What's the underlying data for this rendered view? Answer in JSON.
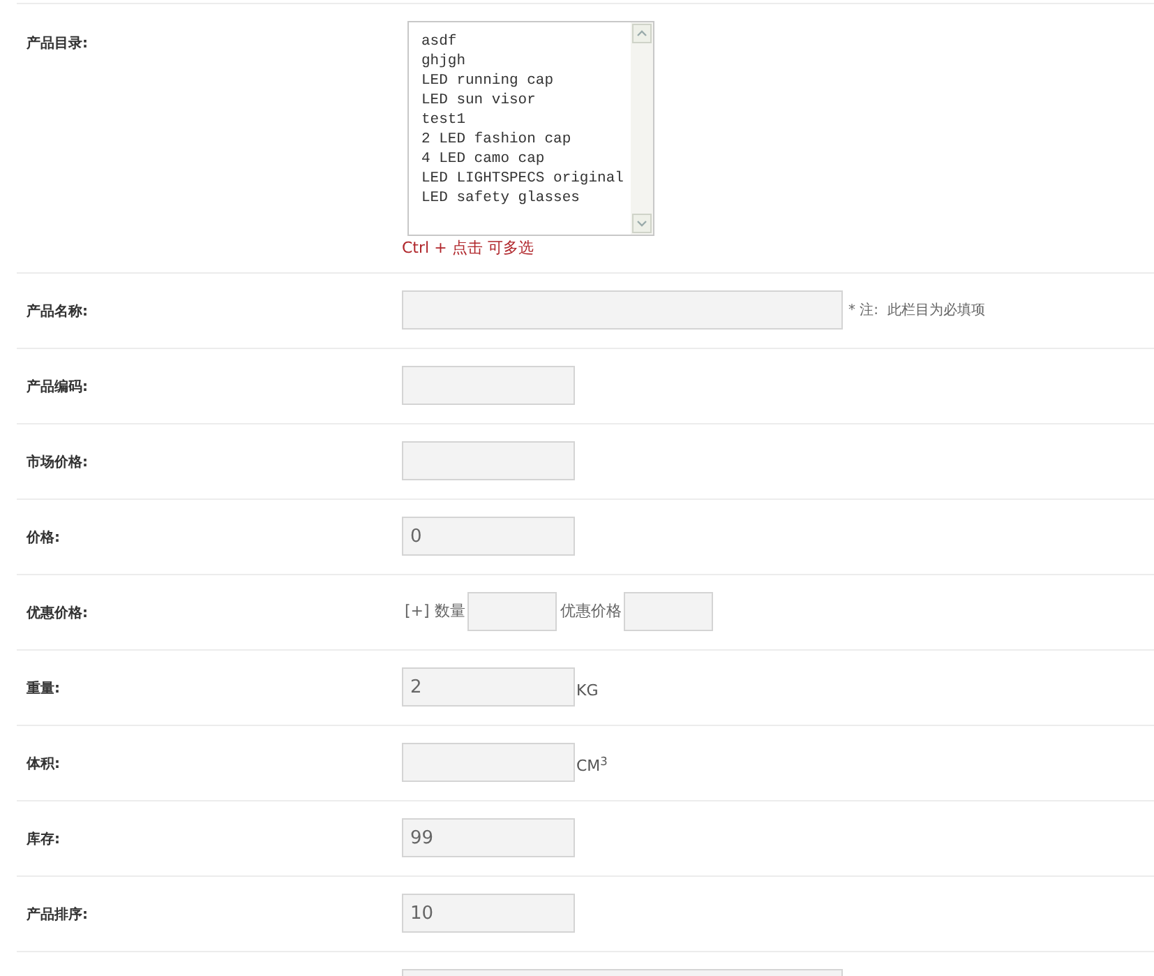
{
  "category": {
    "label": "产品目录:",
    "options": [
      "asdf",
      "ghjgh",
      "LED running cap",
      "LED sun visor",
      "test1",
      "2 LED fashion cap",
      "4 LED camo cap",
      "LED LIGHTSPECS original",
      "LED safety glasses"
    ],
    "hint": "Ctrl + 点击 可多选"
  },
  "rows": [
    {
      "label": "产品名称:",
      "parts": [
        {
          "kind": "longinput"
        },
        {
          "kind": "note",
          "text": "* 注:  此栏目为必填项"
        }
      ]
    },
    {
      "label": "产品编码:",
      "parts": [
        {
          "kind": "input"
        }
      ]
    },
    {
      "label": "市场价格:",
      "parts": [
        {
          "kind": "input"
        }
      ]
    },
    {
      "label": "价格:",
      "parts": [
        {
          "kind": "input",
          "value": "0"
        }
      ]
    },
    {
      "label": "优惠价格:",
      "parts": [
        {
          "kind": "text",
          "text": "[+] 数量"
        },
        {
          "kind": "shortinput"
        },
        {
          "kind": "text",
          "text": "优惠价格"
        },
        {
          "kind": "shortinput"
        }
      ]
    },
    {
      "label": "重量:",
      "parts": [
        {
          "kind": "input",
          "value": "2"
        },
        {
          "kind": "unit",
          "text": "KG"
        }
      ]
    },
    {
      "label": "体积:",
      "parts": [
        {
          "kind": "input"
        },
        {
          "kind": "unit",
          "text": "CM$^{3}$"
        }
      ]
    },
    {
      "label": "库存:",
      "parts": [
        {
          "kind": "input",
          "value": "99"
        }
      ]
    },
    {
      "label": "产品排序:",
      "parts": [
        {
          "kind": "input",
          "value": "10"
        }
      ]
    },
    {
      "parts": [
        {
          "kind": "longinput"
        }
      ]
    }
  ]
}
